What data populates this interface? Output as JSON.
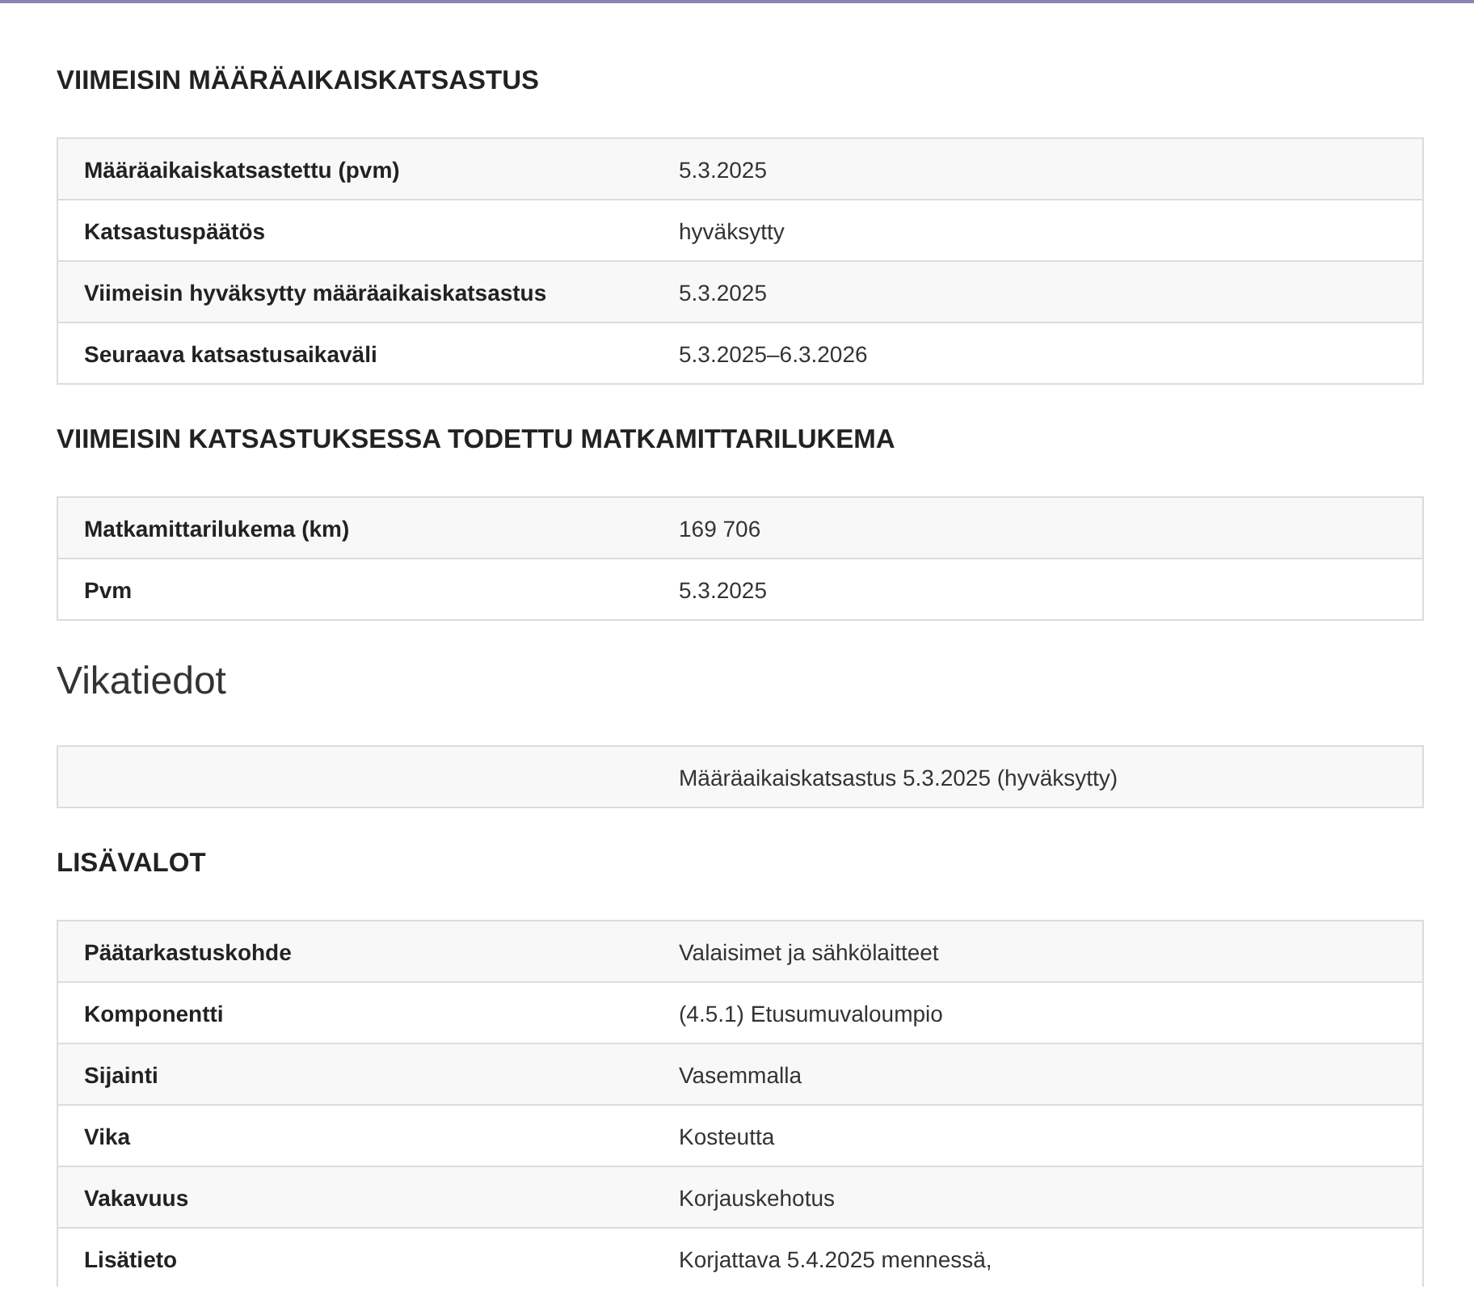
{
  "sections": [
    {
      "kind": "heading",
      "title": "VIIMEISIN MÄÄRÄAIKAISKATSASTUS",
      "rows": [
        {
          "label": "Määräaikaiskatsastettu (pvm)",
          "value": "5.3.2025"
        },
        {
          "label": "Katsastuspäätös",
          "value": "hyväksytty"
        },
        {
          "label": "Viimeisin hyväksytty määräaikaiskatsastus",
          "value": "5.3.2025"
        },
        {
          "label": "Seuraava katsastusaikaväli",
          "value": "5.3.2025–6.3.2026"
        }
      ]
    },
    {
      "kind": "heading",
      "title": "VIIMEISIN KATSASTUKSESSA TODETTU MATKAMITTARILUKEMA",
      "rows": [
        {
          "label": "Matkamittarilukema (km)",
          "value": "169 706"
        },
        {
          "label": "Pvm",
          "value": "5.3.2025"
        }
      ]
    },
    {
      "kind": "title",
      "title": "Vikatiedot",
      "rows": [
        {
          "value": "Määräaikaiskatsastus 5.3.2025 (hyväksytty)"
        }
      ]
    },
    {
      "kind": "heading",
      "title": "LISÄVALOT",
      "rows": [
        {
          "label": "Päätarkastuskohde",
          "value": "Valaisimet ja sähkölaitteet"
        },
        {
          "label": "Komponentti",
          "value": "(4.5.1) Etusumuvaloumpio"
        },
        {
          "label": "Sijainti",
          "value": "Vasemmalla"
        },
        {
          "label": "Vika",
          "value": "Kosteutta"
        },
        {
          "label": "Vakavuus",
          "value": "Korjauskehotus"
        },
        {
          "label": "Lisätieto",
          "value": "Korjattava 5.4.2025 mennessä,"
        }
      ]
    }
  ]
}
